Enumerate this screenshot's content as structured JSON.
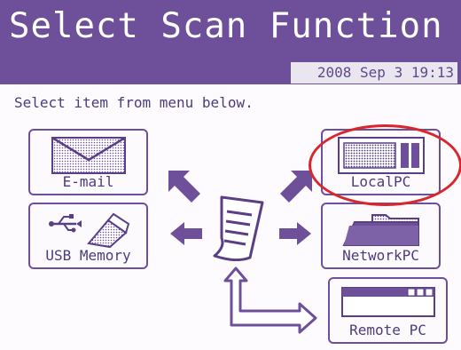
{
  "header": {
    "title": "Select Scan Function",
    "datetime": "2008 Sep  3 19:13"
  },
  "instruction": "Select item from menu below.",
  "buttons": {
    "email": "E-mail",
    "usb": "USB Memory",
    "local_pc": "LocalPC",
    "network_pc": "NetworkPC",
    "remote_pc": "Remote PC"
  },
  "icons": {
    "email": "envelope-icon",
    "usb": "usb-icon",
    "local_pc": "computer-icon",
    "network_pc": "folder-icon",
    "remote_pc": "window-icon",
    "center": "document-icon"
  },
  "colors": {
    "header_bg": "#6e4f9a",
    "accent": "#6e4f9a",
    "text": "#4d3b7c",
    "highlight": "#d9262c"
  }
}
